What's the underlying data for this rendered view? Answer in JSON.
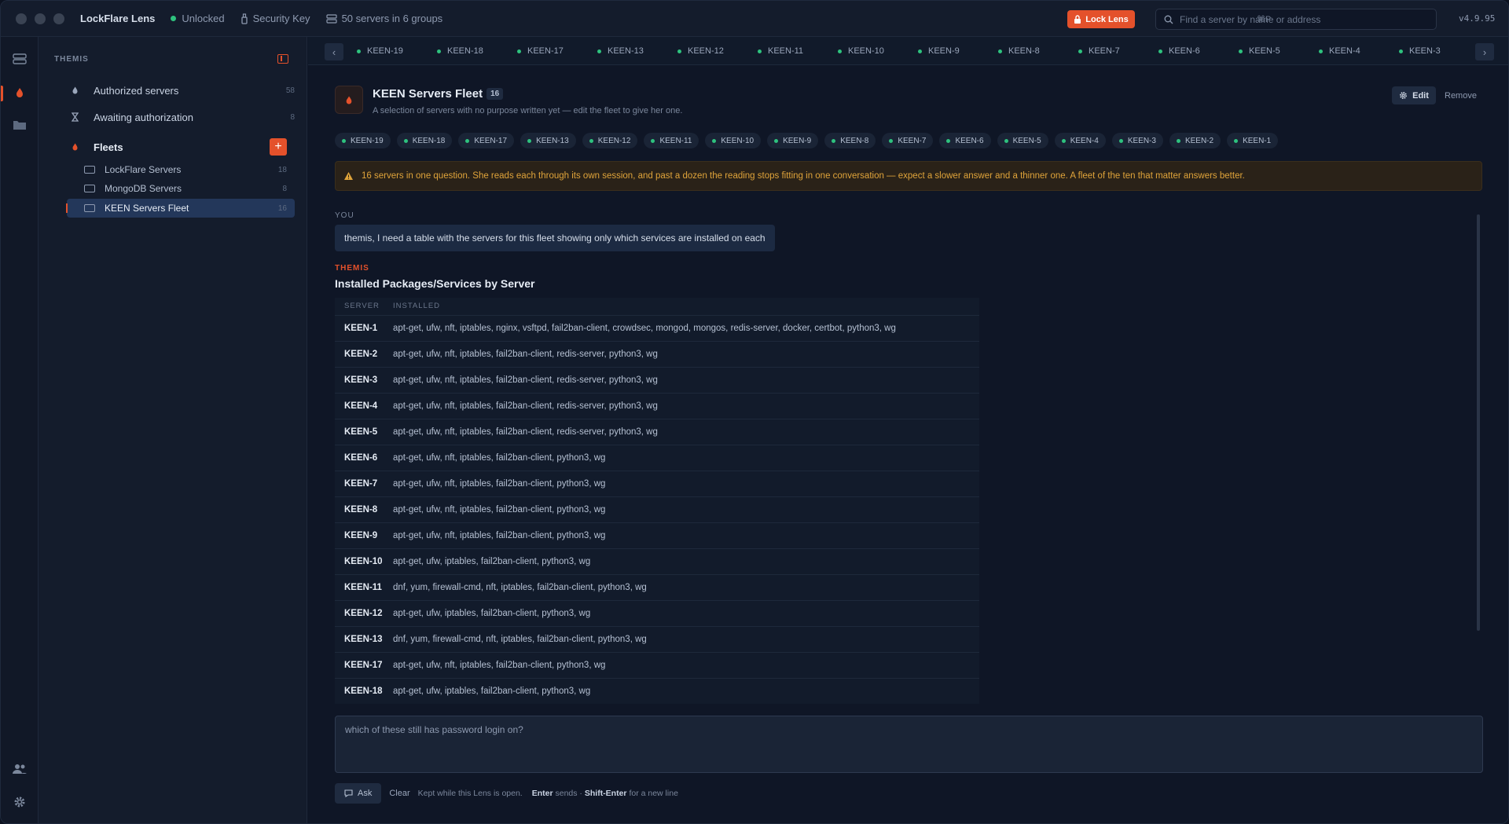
{
  "titlebar": {
    "app_name": "LockFlare Lens",
    "status": "Unlocked",
    "security_key": "Security Key",
    "servers_summary": "50 servers in 6 groups",
    "lock_button": "Lock Lens",
    "search_placeholder": "Find a server by name or address",
    "search_shortcut": "⌘P",
    "version": "v4.9.95"
  },
  "sidebar": {
    "heading": "THEMIS",
    "items": [
      {
        "label": "Authorized servers",
        "count": "58"
      },
      {
        "label": "Awaiting authorization",
        "count": "8"
      }
    ],
    "fleets_label": "Fleets",
    "fleets": [
      {
        "label": "LockFlare Servers",
        "count": "18"
      },
      {
        "label": "MongoDB Servers",
        "count": "8"
      },
      {
        "label": "KEEN Servers Fleet",
        "count": "16"
      }
    ]
  },
  "tabs": [
    "KEEN-19",
    "KEEN-18",
    "KEEN-17",
    "KEEN-13",
    "KEEN-12",
    "KEEN-11",
    "KEEN-10",
    "KEEN-9",
    "KEEN-8",
    "KEEN-7",
    "KEEN-6",
    "KEEN-5",
    "KEEN-4",
    "KEEN-3"
  ],
  "fleet": {
    "title": "KEEN Servers Fleet",
    "count": "16",
    "description": "A selection of servers with no purpose written yet — edit the fleet to give her one.",
    "edit_label": "Edit",
    "remove_label": "Remove",
    "chips": [
      "KEEN-19",
      "KEEN-18",
      "KEEN-17",
      "KEEN-13",
      "KEEN-12",
      "KEEN-11",
      "KEEN-10",
      "KEEN-9",
      "KEEN-8",
      "KEEN-7",
      "KEEN-6",
      "KEEN-5",
      "KEEN-4",
      "KEEN-3",
      "KEEN-2",
      "KEEN-1"
    ]
  },
  "warning": "16 servers in one question. She reads each through its own session, and past a dozen the reading stops fitting in one conversation — expect a slower answer and a thinner one. A fleet of the ten that matter answers better.",
  "conversation": {
    "you_label": "YOU",
    "you_message": "themis, I need a table with the servers for this fleet showing only which services are installed on each",
    "themis_label": "THEMIS",
    "answer_title": "Installed Packages/Services by Server",
    "table": {
      "headers": [
        "SERVER",
        "INSTALLED"
      ],
      "rows": [
        [
          "KEEN-1",
          "apt-get, ufw, nft, iptables, nginx, vsftpd, fail2ban-client, crowdsec, mongod, mongos, redis-server, docker, certbot, python3, wg"
        ],
        [
          "KEEN-2",
          "apt-get, ufw, nft, iptables, fail2ban-client, redis-server, python3, wg"
        ],
        [
          "KEEN-3",
          "apt-get, ufw, nft, iptables, fail2ban-client, redis-server, python3, wg"
        ],
        [
          "KEEN-4",
          "apt-get, ufw, nft, iptables, fail2ban-client, redis-server, python3, wg"
        ],
        [
          "KEEN-5",
          "apt-get, ufw, nft, iptables, fail2ban-client, redis-server, python3, wg"
        ],
        [
          "KEEN-6",
          "apt-get, ufw, nft, iptables, fail2ban-client, python3, wg"
        ],
        [
          "KEEN-7",
          "apt-get, ufw, nft, iptables, fail2ban-client, python3, wg"
        ],
        [
          "KEEN-8",
          "apt-get, ufw, nft, iptables, fail2ban-client, python3, wg"
        ],
        [
          "KEEN-9",
          "apt-get, ufw, nft, iptables, fail2ban-client, python3, wg"
        ],
        [
          "KEEN-10",
          "apt-get, ufw, iptables, fail2ban-client, python3, wg"
        ],
        [
          "KEEN-11",
          "dnf, yum, firewall-cmd, nft, iptables, fail2ban-client, python3, wg"
        ],
        [
          "KEEN-12",
          "apt-get, ufw, iptables, fail2ban-client, python3, wg"
        ],
        [
          "KEEN-13",
          "dnf, yum, firewall-cmd, nft, iptables, fail2ban-client, python3, wg"
        ],
        [
          "KEEN-17",
          "apt-get, ufw, nft, iptables, fail2ban-client, python3, wg"
        ],
        [
          "KEEN-18",
          "apt-get, ufw, iptables, fail2ban-client, python3, wg"
        ]
      ]
    }
  },
  "composer": {
    "placeholder": "which of these still has password login on?",
    "ask_label": "Ask",
    "clear_label": "Clear",
    "hint_kept": "Kept while this Lens is open.",
    "hint_enter": "Enter",
    "hint_sends": "sends ·",
    "hint_shift": "Shift-Enter",
    "hint_newline": "for a new line"
  },
  "colors": {
    "accent": "#e4512b",
    "online": "#2ec27e",
    "warning": "#e0a43a"
  }
}
